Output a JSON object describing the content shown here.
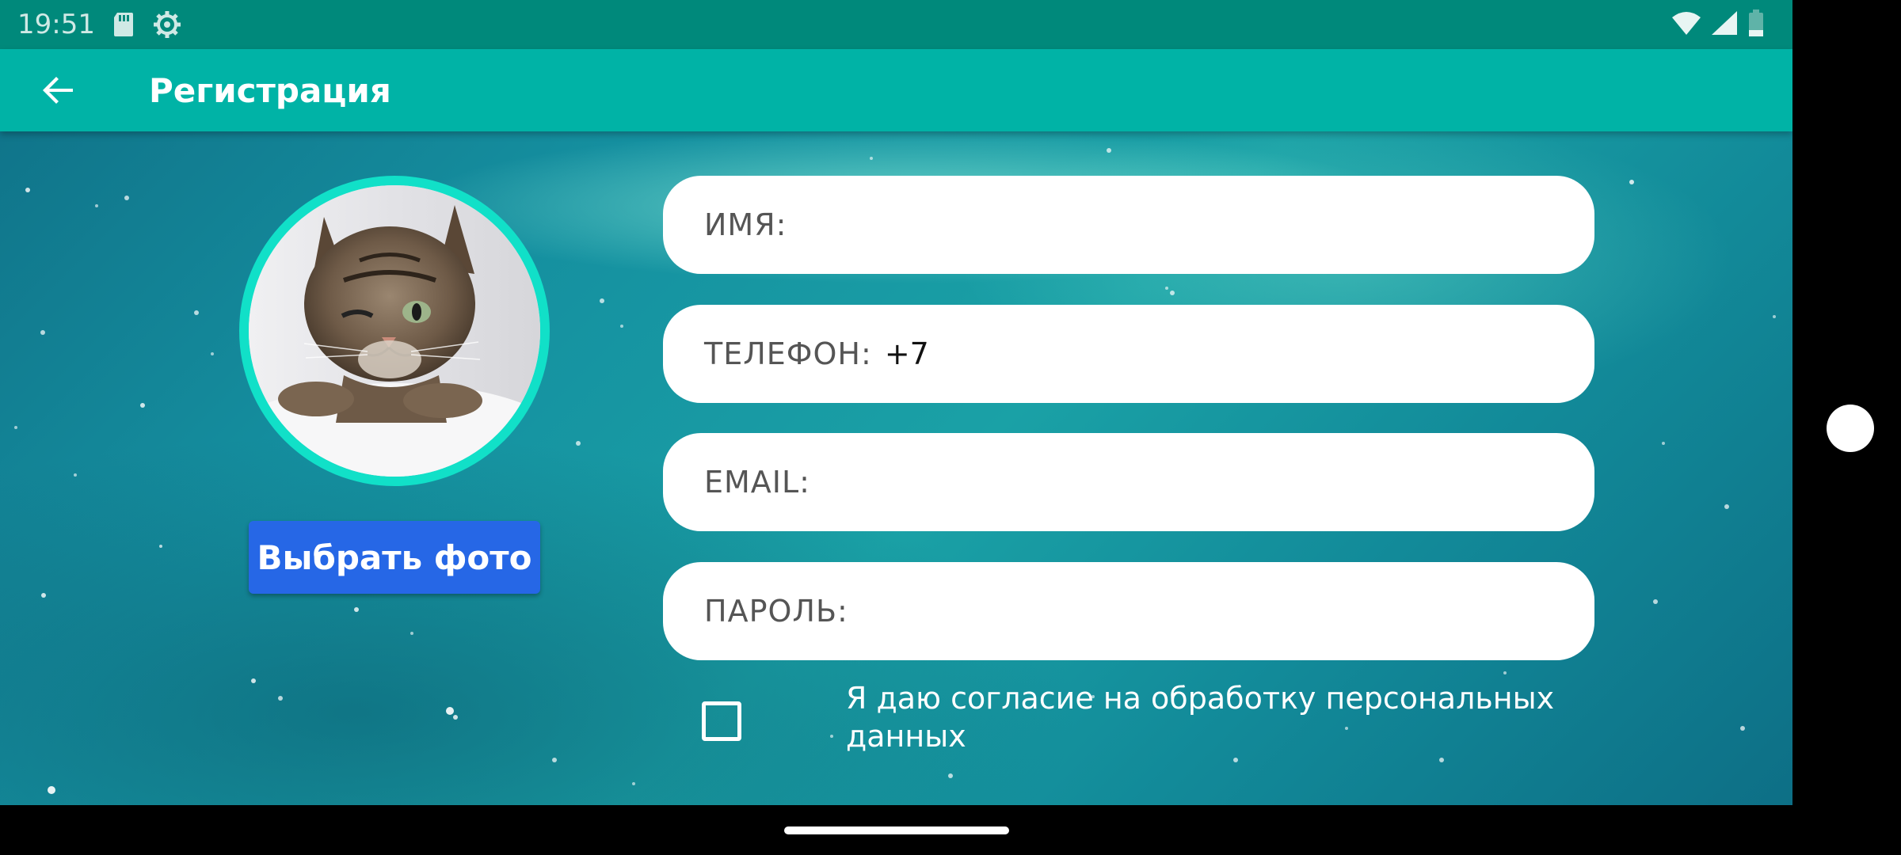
{
  "status_bar": {
    "time": "19:51",
    "icons_left": [
      "sd-card-icon",
      "settings-gear-icon"
    ],
    "icons_right": [
      "wifi-icon",
      "signal-icon",
      "battery-icon"
    ]
  },
  "app_bar": {
    "back_icon": "arrow-left-icon",
    "title": "Регистрация"
  },
  "profile": {
    "photo_subject": "cat",
    "choose_photo_label": "Выбрать фото"
  },
  "form": {
    "name_label": "ИМЯ:",
    "name_value": "",
    "phone_label": "ТЕЛЕФОН:",
    "phone_value": "+7",
    "email_label": "EMAIL:",
    "email_value": "",
    "password_label": "ПАРОЛЬ:",
    "password_value": "",
    "consent_checked": false,
    "consent_text": "Я даю согласие на обработку персональных данных"
  },
  "colors": {
    "status_bar": "#00897b",
    "app_bar": "#00b3a6",
    "avatar_ring": "#11e0c8",
    "button": "#2667e6"
  }
}
